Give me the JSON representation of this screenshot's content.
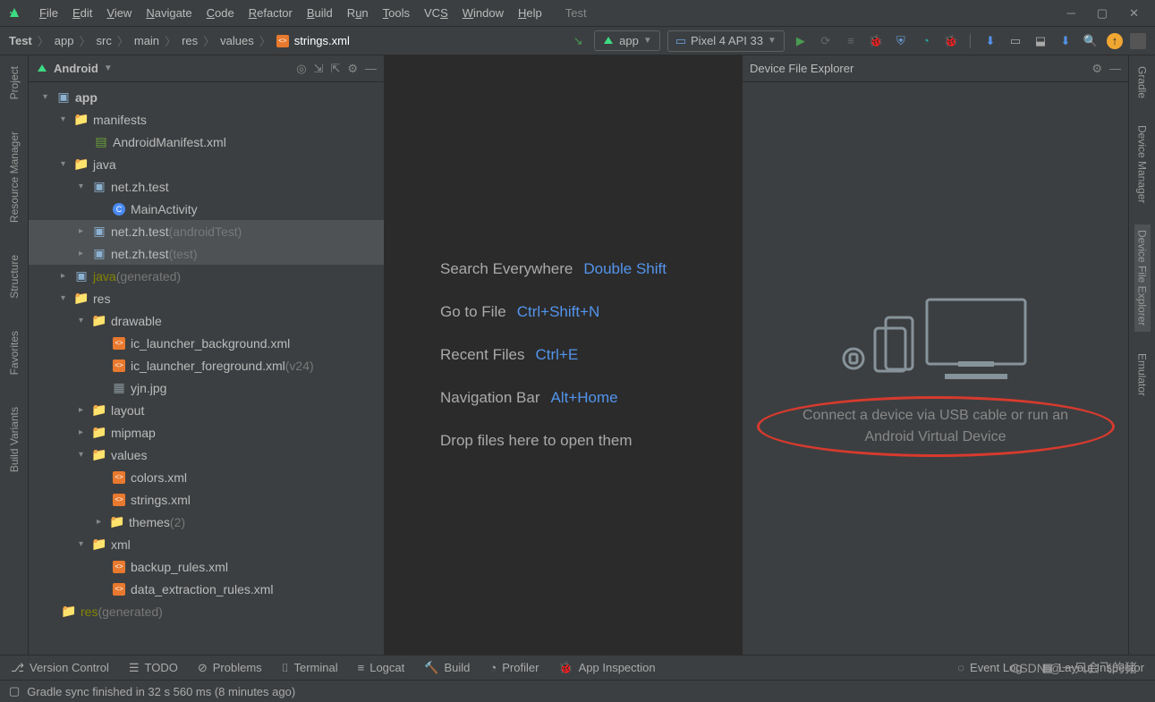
{
  "window": {
    "project": "Test"
  },
  "menu": [
    "File",
    "Edit",
    "View",
    "Navigate",
    "Code",
    "Refactor",
    "Build",
    "Run",
    "Tools",
    "VCS",
    "Window",
    "Help"
  ],
  "breadcrumb": [
    "Test",
    "app",
    "src",
    "main",
    "res",
    "values",
    "strings.xml"
  ],
  "run_config": {
    "module": "app",
    "device": "Pixel 4 API 33"
  },
  "project_panel": {
    "title": "Android"
  },
  "tree": {
    "app": "app",
    "manifests": "manifests",
    "manifest_file": "AndroidManifest.xml",
    "java": "java",
    "pkg_main": "net.zh.test",
    "activity": "MainActivity",
    "pkg_android_test": "net.zh.test",
    "pkg_android_test_suffix": "(androidTest)",
    "pkg_test": "net.zh.test",
    "pkg_test_suffix": "(test)",
    "java_gen": "java",
    "gen_suffix": "(generated)",
    "res": "res",
    "drawable": "drawable",
    "ic_bg": "ic_launcher_background.xml",
    "ic_fg": "ic_launcher_foreground.xml",
    "ic_fg_suffix": "(v24)",
    "yjn": "yjn.jpg",
    "layout": "layout",
    "mipmap": "mipmap",
    "values": "values",
    "colors": "colors.xml",
    "strings": "strings.xml",
    "themes": "themes",
    "themes_suffix": "(2)",
    "xml": "xml",
    "backup": "backup_rules.xml",
    "data_ext": "data_extraction_rules.xml",
    "res_gen": "res",
    "res_gen_suffix": "(generated)"
  },
  "center": {
    "search": "Search Everywhere",
    "search_key": "Double Shift",
    "goto": "Go to File",
    "goto_key": "Ctrl+Shift+N",
    "recent": "Recent Files",
    "recent_key": "Ctrl+E",
    "nav": "Navigation Bar",
    "nav_key": "Alt+Home",
    "drop": "Drop files here to open them"
  },
  "device_explorer": {
    "title": "Device File Explorer",
    "message_l1": "Connect a device via USB cable or run an",
    "message_l2": "Android Virtual Device"
  },
  "bottom": {
    "vc": "Version Control",
    "todo": "TODO",
    "problems": "Problems",
    "terminal": "Terminal",
    "logcat": "Logcat",
    "build": "Build",
    "profiler": "Profiler",
    "appinsp": "App Inspection",
    "event": "Event Log",
    "layout": "Layout Inspector"
  },
  "status": {
    "msg": "Gradle sync finished in 32 s 560 ms (8 minutes ago)"
  },
  "sidebar_left": [
    "Project",
    "Resource Manager",
    "Structure",
    "Favorites",
    "Build Variants"
  ],
  "sidebar_right": [
    "Gradle",
    "Device Manager",
    "Device File Explorer",
    "Emulator"
  ],
  "watermark": "CSDN @一只会飞的猪"
}
